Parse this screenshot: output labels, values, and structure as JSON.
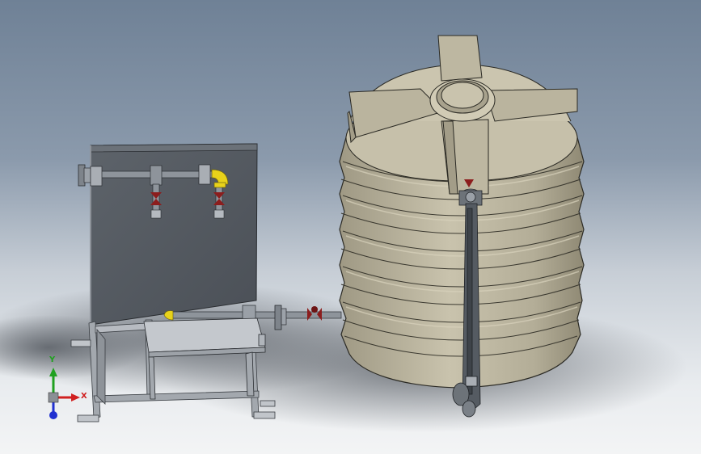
{
  "viewport": {
    "background_top": "#6f8196",
    "background_bottom": "#f3f4f5"
  },
  "model": {
    "tank_color": "#b9b39e",
    "frame_color": "#9aa0a8",
    "panel_color": "#555b62",
    "pipe_color": "#8e949b",
    "fitting_color": "#e8d21a",
    "valve_color": "#8c1d1d"
  },
  "triad": {
    "x_label": "X",
    "y_label": "Y",
    "x_color": "#d02020",
    "y_color": "#20a020",
    "z_color": "#2030d0"
  }
}
